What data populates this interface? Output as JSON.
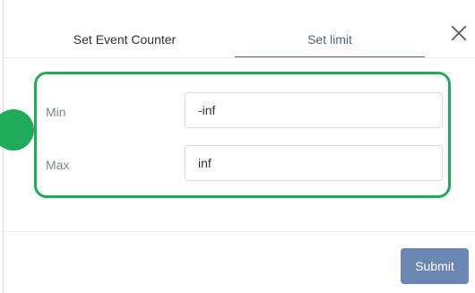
{
  "dialog": {
    "tabs": [
      {
        "label": "Set Event Counter",
        "active": false
      },
      {
        "label": "Set limit",
        "active": true
      }
    ],
    "close_icon": "close-icon"
  },
  "form": {
    "min": {
      "label": "Min",
      "value": "-inf"
    },
    "max": {
      "label": "Max",
      "value": "inf"
    }
  },
  "footer": {
    "submit_label": "Submit"
  },
  "colors": {
    "highlight": "#1fab59",
    "active_tab": "#51647e",
    "submit_button": "#6b86b3"
  }
}
